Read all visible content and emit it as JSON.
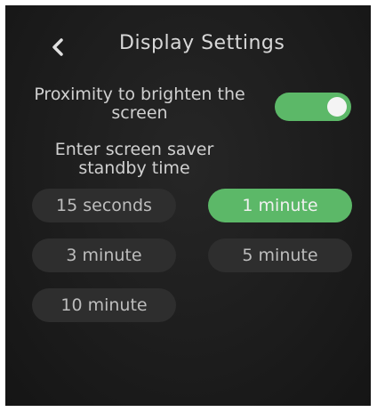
{
  "header": {
    "back_icon": "chevron-left-icon",
    "title": "Display Settings"
  },
  "proximity": {
    "label": "Proximity to brighten the screen",
    "enabled": true
  },
  "screen_saver": {
    "label": "Enter screen saver standby time",
    "options": [
      {
        "label": "15 seconds",
        "selected": false
      },
      {
        "label": "1 minute",
        "selected": true
      },
      {
        "label": "3 minute",
        "selected": false
      },
      {
        "label": "5 minute",
        "selected": false
      },
      {
        "label": "10 minute",
        "selected": false
      }
    ]
  },
  "colors": {
    "background": "#1c1c1c",
    "accent": "#5cb868",
    "option_bg": "#2e2e2e",
    "text": "#d0d0d0"
  }
}
